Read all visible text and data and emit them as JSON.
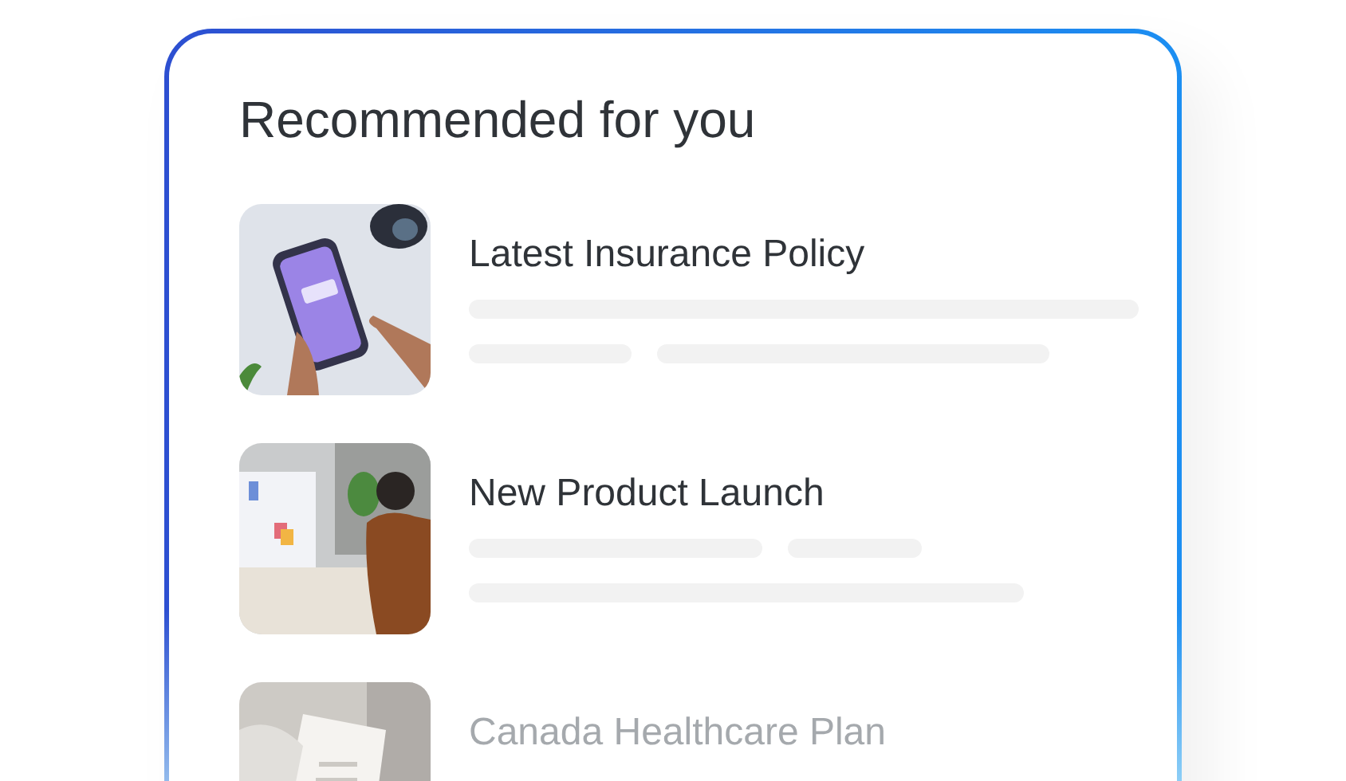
{
  "card": {
    "title": "Recommended for you",
    "items": [
      {
        "title": "Latest Insurance Policy",
        "dimmed": false
      },
      {
        "title": "New Product Launch",
        "dimmed": false
      },
      {
        "title": "Canada Healthcare Plan",
        "dimmed": true
      }
    ]
  }
}
